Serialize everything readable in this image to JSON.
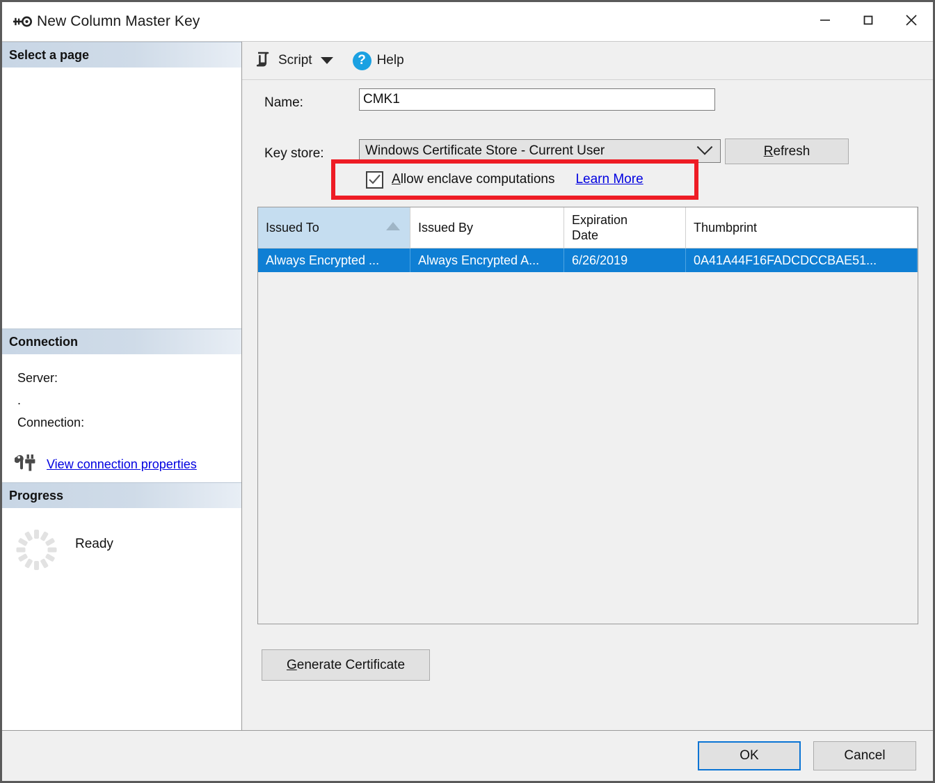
{
  "window": {
    "title": "New Column Master Key",
    "title_icon": "key-icon",
    "controls": {
      "minimize": "─",
      "maximize": "□",
      "close": "✕"
    }
  },
  "sidebar": {
    "select_page_header": "Select a page",
    "connection_header": "Connection",
    "connection": {
      "server_label": "Server:",
      "server_value": ".",
      "connection_label": "Connection:",
      "view_properties_link": "View connection properties",
      "link_icon": "connection-properties-icon"
    },
    "progress_header": "Progress",
    "progress": {
      "status": "Ready",
      "spinner_icon": "progress-spinner-icon"
    }
  },
  "toolbar": {
    "script_icon": "script-icon",
    "script_label": "Script",
    "script_dropdown_icon": "chevron-down-icon",
    "help_icon": "help-icon",
    "help_icon_glyph": "?",
    "help_label": "Help"
  },
  "form": {
    "name_label": "Name:",
    "name_value": "CMK1",
    "name_placeholder": "",
    "key_store_label": "Key store:",
    "key_store_value": "Windows Certificate Store - Current User",
    "key_store_caret_icon": "chevron-down-icon",
    "refresh_button": "Refresh",
    "refresh_accel": "R",
    "enclave": {
      "checkbox_checked": true,
      "checkbox_icon": "checkmark-icon",
      "label_accel": "A",
      "label_rest": "llow enclave computations",
      "label_full": "Allow enclave computations",
      "learn_more": "Learn More",
      "highlight_color": "#ee1c25"
    },
    "generate_button": "Generate Certificate",
    "generate_accel": "G"
  },
  "grid": {
    "columns": [
      {
        "label": "Issued To",
        "sorted": true,
        "sort_icon": "sort-ascending-icon"
      },
      {
        "label": "Issued By",
        "sorted": false
      },
      {
        "label": "Expiration\nDate",
        "line1": "Expiration",
        "line2": "Date",
        "sorted": false
      },
      {
        "label": "Thumbprint",
        "sorted": false
      }
    ],
    "rows": [
      {
        "issued_to": "Always Encrypted ...",
        "issued_by": "Always Encrypted A...",
        "expiration_date": "6/26/2019",
        "thumbprint": "0A41A44F16FADCDCCBAE51...",
        "selected": true
      }
    ],
    "selection_color": "#0f7fd4"
  },
  "footer": {
    "ok_label": "OK",
    "cancel_label": "Cancel"
  }
}
